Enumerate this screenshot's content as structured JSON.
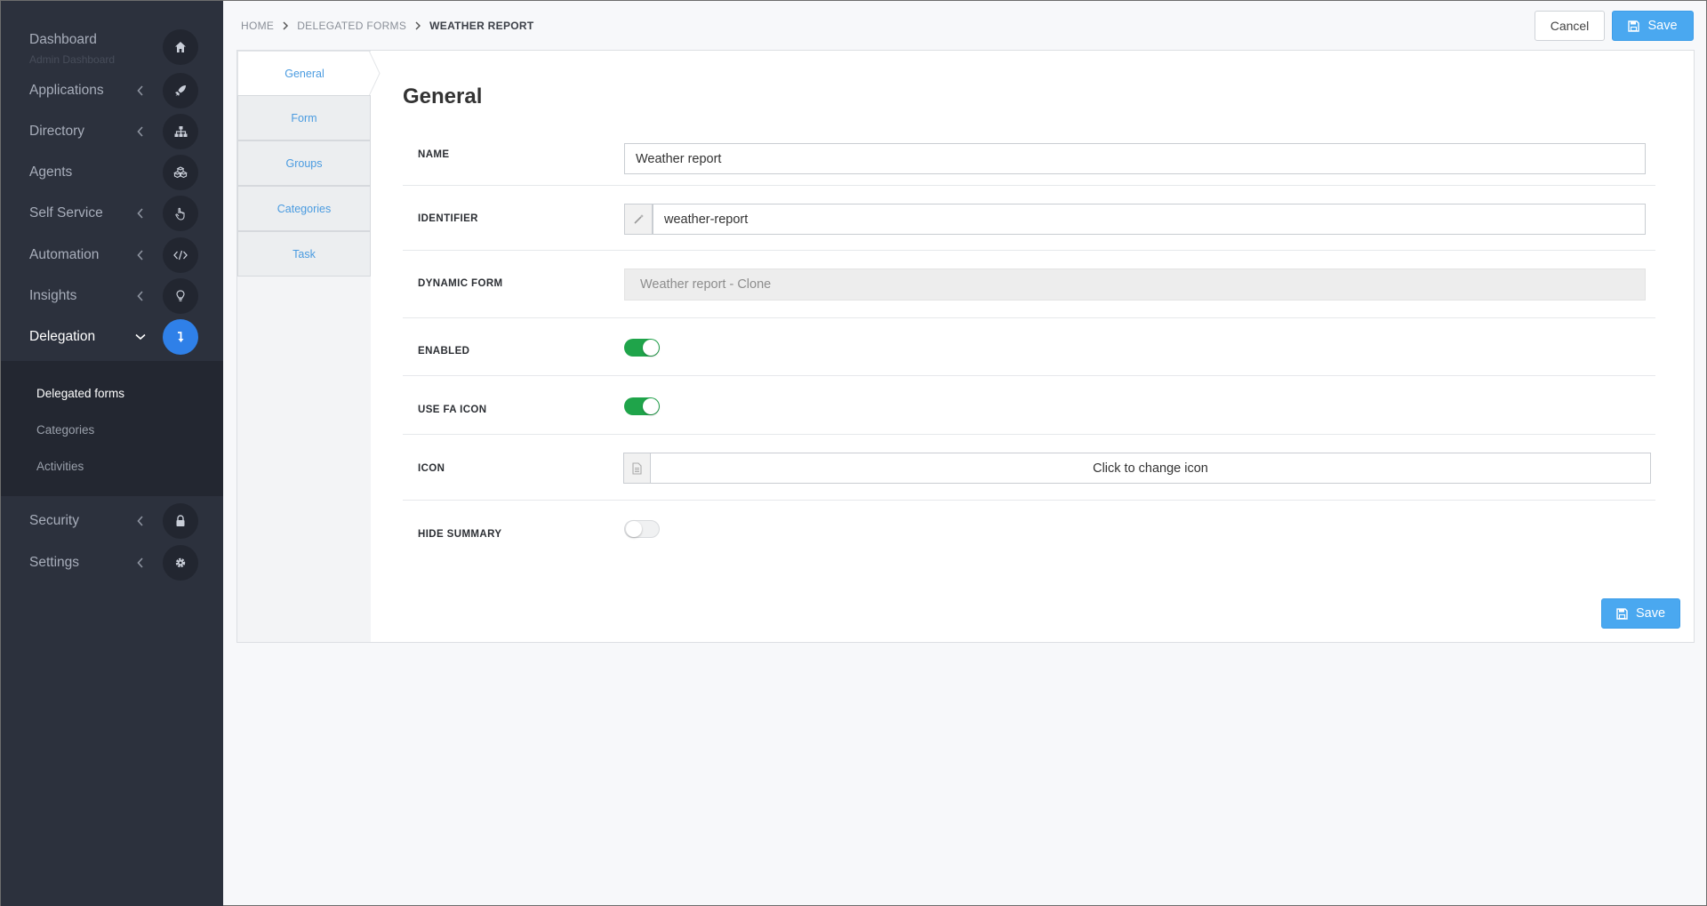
{
  "sidebar": {
    "items": [
      {
        "label": "Dashboard",
        "sublabel": "Admin Dashboard",
        "icon": "home-icon"
      },
      {
        "label": "Applications",
        "icon": "rocket-icon"
      },
      {
        "label": "Directory",
        "icon": "sitemap-icon"
      },
      {
        "label": "Agents",
        "icon": "cubes-icon"
      },
      {
        "label": "Self Service",
        "icon": "hand-pointer-icon"
      },
      {
        "label": "Automation",
        "icon": "code-icon"
      },
      {
        "label": "Insights",
        "icon": "lightbulb-icon"
      },
      {
        "label": "Delegation",
        "icon": "level-down-icon"
      },
      {
        "label": "Security",
        "icon": "lock-icon"
      },
      {
        "label": "Settings",
        "icon": "gear-icon"
      }
    ],
    "delegation_submenu": [
      "Delegated forms",
      "Categories",
      "Activities"
    ]
  },
  "breadcrumb": [
    "HOME",
    "DELEGATED FORMS",
    "WEATHER REPORT"
  ],
  "actions": {
    "cancel": "Cancel",
    "save": "Save"
  },
  "tabs": [
    "General",
    "Form",
    "Groups",
    "Categories",
    "Task"
  ],
  "form": {
    "title": "General",
    "name": {
      "label": "NAME",
      "value": "Weather report"
    },
    "identifier": {
      "label": "IDENTIFIER",
      "value": "weather-report"
    },
    "dynamic_form": {
      "label": "DYNAMIC FORM",
      "value": "Weather report - Clone"
    },
    "enabled": {
      "label": "ENABLED",
      "on": true
    },
    "use_fa_icon": {
      "label": "USE FA ICON",
      "on": true
    },
    "icon": {
      "label": "ICON",
      "button": "Click to change icon"
    },
    "hide_summary": {
      "label": "HIDE SUMMARY",
      "on": false
    }
  },
  "colors": {
    "sidebar_bg": "#2c313d",
    "accent_blue": "#2f80e8",
    "save_blue": "#4aa8f0",
    "toggle_green": "#1fa44a",
    "tab_text": "#4a9be0"
  }
}
